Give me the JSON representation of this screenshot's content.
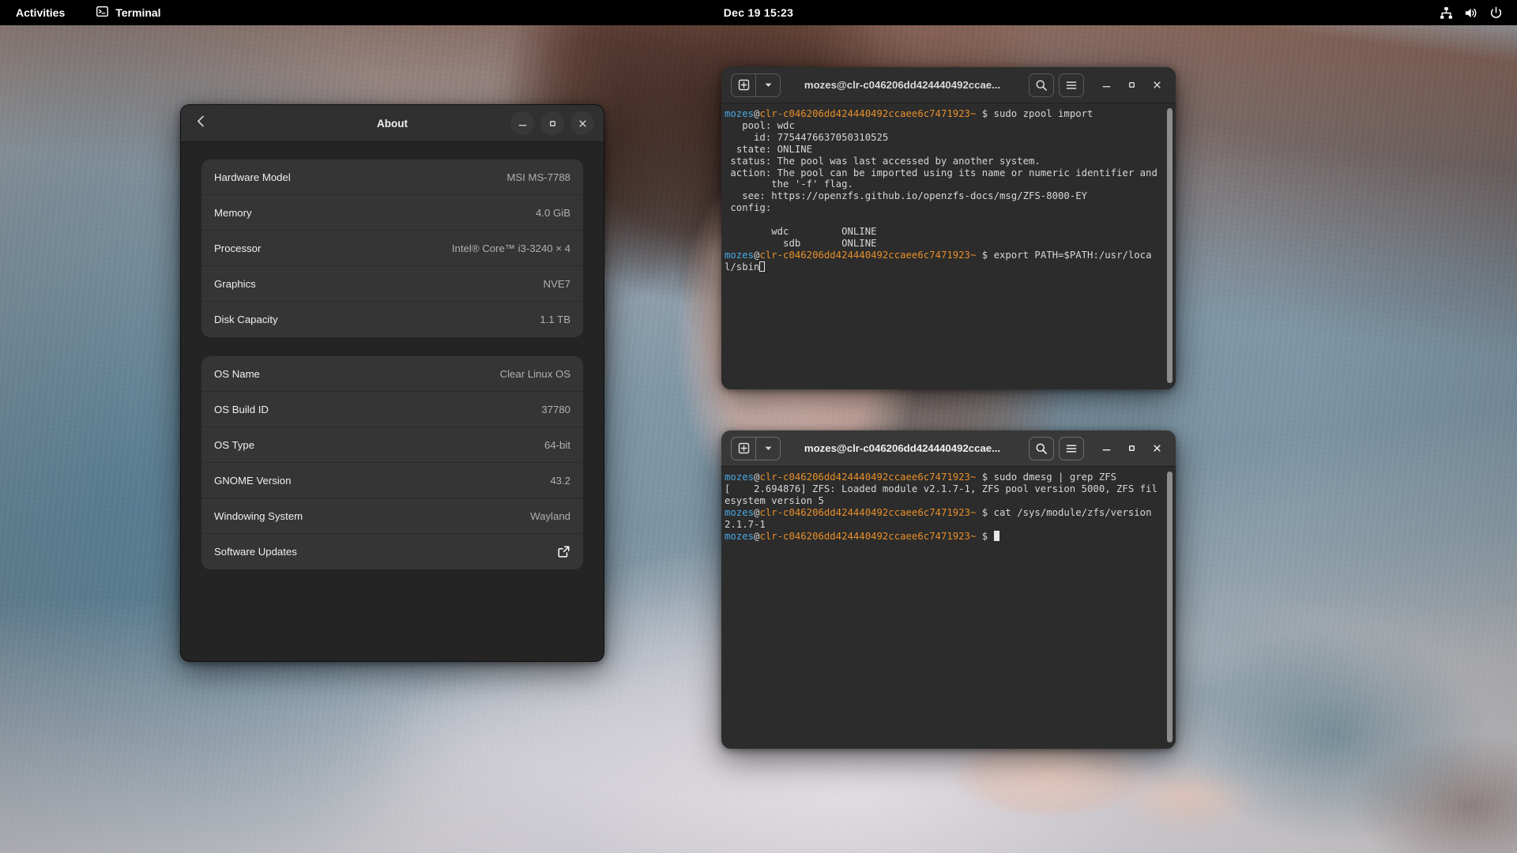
{
  "topbar": {
    "activities": "Activities",
    "app_name": "Terminal",
    "app_icon": "terminal-icon",
    "clock": "Dec 19  15:23",
    "status_icons": [
      "network-wired-icon",
      "volume-icon",
      "power-icon"
    ]
  },
  "about": {
    "title": "About",
    "back_icon": "chevron-left-icon",
    "controls": {
      "minimize": "–",
      "maximize": "□",
      "close": "✕"
    },
    "hardware": [
      {
        "label": "Hardware Model",
        "value": "MSI MS-7788"
      },
      {
        "label": "Memory",
        "value": "4.0 GiB"
      },
      {
        "label": "Processor",
        "value": "Intel® Core™ i3-3240 × 4"
      },
      {
        "label": "Graphics",
        "value": "NVE7"
      },
      {
        "label": "Disk Capacity",
        "value": "1.1 TB"
      }
    ],
    "software": [
      {
        "label": "OS Name",
        "value": "Clear Linux OS"
      },
      {
        "label": "OS Build ID",
        "value": "37780"
      },
      {
        "label": "OS Type",
        "value": "64-bit"
      },
      {
        "label": "GNOME Version",
        "value": "43.2"
      },
      {
        "label": "Windowing System",
        "value": "Wayland"
      },
      {
        "label": "Software Updates",
        "value": "",
        "icon": "external-link-icon"
      }
    ]
  },
  "terminal1": {
    "title": "mozes@clr-c046206dd424440492ccae...",
    "new_tab_icon": "new-tab-icon",
    "dropdown_icon": "chevron-down-icon",
    "search_icon": "search-icon",
    "menu_icon": "hamburger-menu-icon",
    "prompt_user": "mozes",
    "prompt_at": "@",
    "prompt_host": "clr-c046206dd424440492ccaee6c7471923~",
    "prompt_symbol": " $ ",
    "lines": [
      {
        "type": "prompt",
        "command": "sudo zpool import"
      },
      {
        "type": "output",
        "text": "   pool: wdc"
      },
      {
        "type": "output",
        "text": "     id: 7754476637050310525"
      },
      {
        "type": "output",
        "text": "  state: ONLINE"
      },
      {
        "type": "output",
        "text": " status: The pool was last accessed by another system."
      },
      {
        "type": "output",
        "text": " action: The pool can be imported using its name or numeric identifier and"
      },
      {
        "type": "output",
        "text": "        the '-f' flag."
      },
      {
        "type": "output",
        "text": "   see: https://openzfs.github.io/openzfs-docs/msg/ZFS-8000-EY"
      },
      {
        "type": "output",
        "text": " config:"
      },
      {
        "type": "output",
        "text": ""
      },
      {
        "type": "output",
        "text": "        wdc         ONLINE"
      },
      {
        "type": "output",
        "text": "          sdb       ONLINE"
      },
      {
        "type": "prompt",
        "command": "export PATH=$PATH:/usr/local/sbin",
        "cursor": "hollow"
      }
    ]
  },
  "terminal2": {
    "title": "mozes@clr-c046206dd424440492ccae...",
    "new_tab_icon": "new-tab-icon",
    "dropdown_icon": "chevron-down-icon",
    "search_icon": "search-icon",
    "menu_icon": "hamburger-menu-icon",
    "prompt_user": "mozes",
    "prompt_at": "@",
    "prompt_host": "clr-c046206dd424440492ccaee6c7471923~",
    "prompt_symbol": " $ ",
    "lines": [
      {
        "type": "prompt",
        "command": "sudo dmesg | grep ZFS"
      },
      {
        "type": "output",
        "text": "[    2.694876] ZFS: Loaded module v2.1.7-1, ZFS pool version 5000, ZFS filesystem version 5"
      },
      {
        "type": "prompt",
        "command": "cat /sys/module/zfs/version"
      },
      {
        "type": "output",
        "text": "2.1.7-1"
      },
      {
        "type": "prompt",
        "command": "",
        "cursor": "block"
      }
    ]
  },
  "colors": {
    "prompt_user": "#4aa8e0",
    "prompt_host": "#e88f29",
    "terminal_bg": "#2c2c2c",
    "terminal_fg": "#d6d6d6",
    "window_bg": "#242424",
    "card_bg": "#353535",
    "topbar_bg": "#000000"
  }
}
